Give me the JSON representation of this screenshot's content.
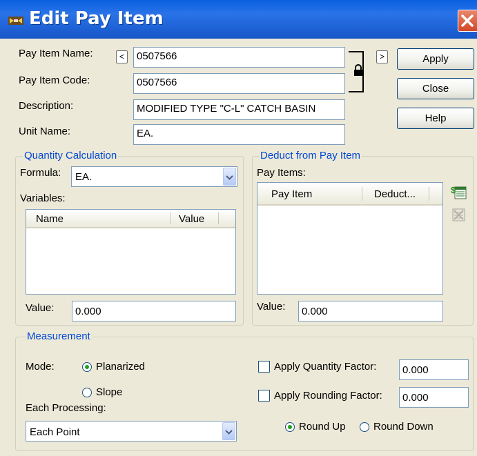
{
  "window": {
    "title": "Edit Pay Item"
  },
  "pay_item": {
    "name_label": "Pay Item Name:",
    "name_value": "0507566",
    "code_label": "Pay Item Code:",
    "code_value": "0507566",
    "description_label": "Description:",
    "description_value": "MODIFIED TYPE \"C-L\" CATCH BASIN",
    "unit_label": "Unit Name:",
    "unit_value": "EA.",
    "prev_label": "<",
    "next_label": ">"
  },
  "buttons": {
    "apply": "Apply",
    "close": "Close",
    "help": "Help"
  },
  "quantity_calculation": {
    "title": "Quantity Calculation",
    "formula_label": "Formula:",
    "formula_value": "EA.",
    "variables_label": "Variables:",
    "columns": [
      "Name",
      "Value"
    ],
    "value_label": "Value:",
    "value": "0.000"
  },
  "deduct": {
    "title": "Deduct from Pay Item",
    "pay_items_label": "Pay Items:",
    "columns": [
      "Pay Item",
      "Deduct..."
    ],
    "value_label": "Value:",
    "value": "0.000"
  },
  "measurement": {
    "title": "Measurement",
    "mode_label": "Mode:",
    "mode_options": [
      "Planarized",
      "Slope"
    ],
    "mode_selected": "Planarized",
    "each_processing_label": "Each Processing:",
    "each_processing_value": "Each Point",
    "apply_quantity_factor_label": "Apply Quantity Factor:",
    "apply_quantity_factor_checked": false,
    "apply_quantity_factor_value": "0.000",
    "apply_rounding_factor_label": "Apply Rounding Factor:",
    "apply_rounding_factor_checked": false,
    "apply_rounding_factor_value": "0.000",
    "round_options": [
      "Round Up",
      "Round Down"
    ],
    "round_selected": "Round Up"
  },
  "colors": {
    "title_bar": "#1F63D8",
    "group_title": "#0046D5",
    "background": "#ECE9D8"
  }
}
